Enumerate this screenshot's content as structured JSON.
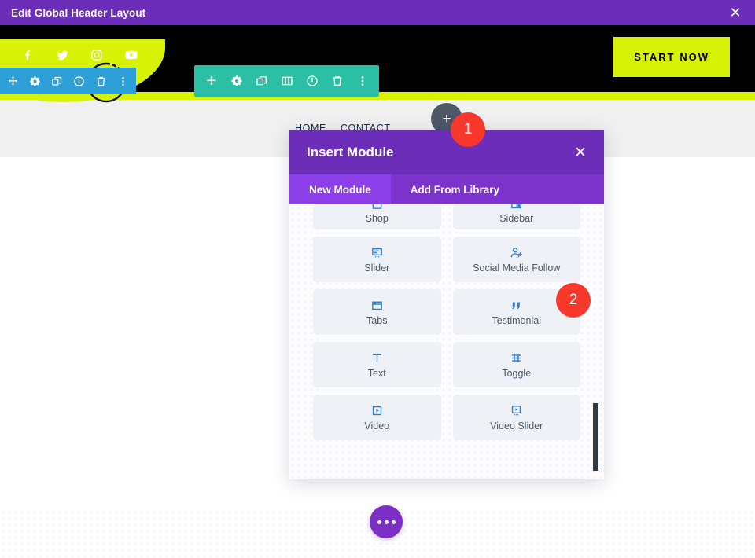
{
  "admin_bar": {
    "title": "Edit Global Header Layout",
    "close_icon": "close-icon"
  },
  "site": {
    "social_icons": [
      {
        "name": "facebook-icon",
        "label": "Facebook"
      },
      {
        "name": "twitter-icon",
        "label": "Twitter"
      },
      {
        "name": "instagram-icon",
        "label": "Instagram"
      },
      {
        "name": "youtube-icon",
        "label": "YouTube"
      }
    ],
    "cta_label": "START NOW",
    "logo_name": "site-logo",
    "nav_items": [
      "HOME",
      "CONTACT"
    ],
    "colors": {
      "band": "#000000",
      "accent_lime": "#d7f205",
      "header_gray": "#f0f0f0"
    }
  },
  "toolbars": {
    "module_toolbar": {
      "color": "#2d9fd9",
      "icons": [
        "move-icon",
        "gear-icon",
        "duplicate-icon",
        "power-icon",
        "trash-icon",
        "more-options-icon"
      ]
    },
    "row_toolbar": {
      "color": "#2bbfa4",
      "icons": [
        "move-icon",
        "gear-icon",
        "duplicate-icon",
        "columns-icon",
        "power-icon",
        "trash-icon",
        "more-options-icon"
      ]
    },
    "add_button_label": "+"
  },
  "modal": {
    "title": "Insert Module",
    "close_icon": "close-icon",
    "tabs": [
      {
        "label": "New Module",
        "active": true
      },
      {
        "label": "Add From Library",
        "active": false
      }
    ],
    "modules": [
      {
        "label": "Shop",
        "icon": "shop-bag-icon",
        "partial": true
      },
      {
        "label": "Sidebar",
        "icon": "sidebar-icon",
        "partial": true
      },
      {
        "label": "Slider",
        "icon": "slider-icon",
        "partial": false
      },
      {
        "label": "Social Media Follow",
        "icon": "social-follow-icon",
        "partial": false
      },
      {
        "label": "Tabs",
        "icon": "tabs-icon",
        "partial": false
      },
      {
        "label": "Testimonial",
        "icon": "quote-icon",
        "partial": false
      },
      {
        "label": "Text",
        "icon": "text-icon",
        "partial": false
      },
      {
        "label": "Toggle",
        "icon": "toggle-icon",
        "partial": false
      },
      {
        "label": "Video",
        "icon": "video-icon",
        "partial": false
      },
      {
        "label": "Video Slider",
        "icon": "video-slider-icon",
        "partial": false
      }
    ],
    "scrollbar_name": "modal-scrollbar"
  },
  "fab": {
    "name": "page-settings-fab",
    "icon": "ellipsis-icon"
  },
  "badges": [
    {
      "number": "1"
    },
    {
      "number": "2"
    }
  ]
}
